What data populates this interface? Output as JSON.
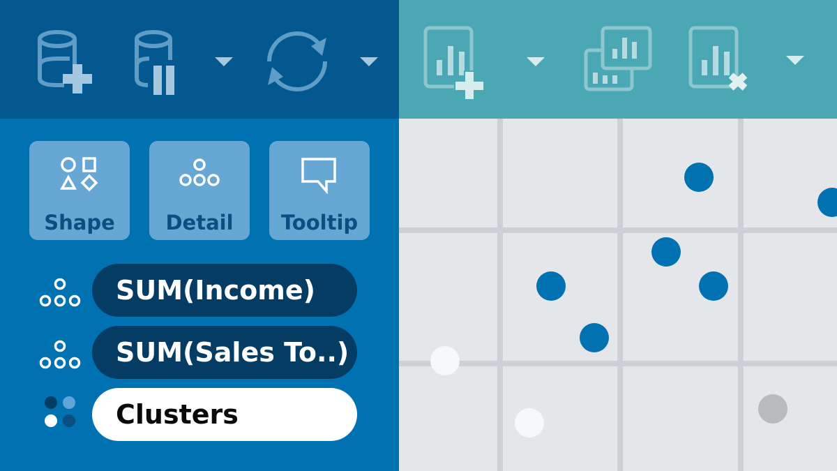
{
  "toolbar_left": {
    "icons": [
      "new-data-source-icon",
      "pause-auto-updates-icon",
      "dropdown-arrow-icon",
      "refresh-icon",
      "dropdown-arrow-icon"
    ]
  },
  "toolbar_right": {
    "icons": [
      "new-worksheet-icon",
      "dropdown-arrow-icon",
      "duplicate-sheet-icon",
      "clear-sheet-icon",
      "dropdown-arrow-icon"
    ]
  },
  "marks_card": {
    "buttons": [
      {
        "label": "Shape",
        "icon": "shape-icon"
      },
      {
        "label": "Detail",
        "icon": "detail-icon"
      },
      {
        "label": "Tooltip",
        "icon": "tooltip-icon"
      }
    ],
    "fields": [
      {
        "label": "SUM(Income)",
        "icon": "detail-icon",
        "style": "dark"
      },
      {
        "label": "SUM(Sales To..)",
        "icon": "detail-icon",
        "style": "dark"
      },
      {
        "label": "Clusters",
        "icon": "color-icon",
        "style": "light"
      }
    ]
  },
  "colors": {
    "toolbar_left": "#03598f",
    "toolbar_right": "#4aa8b4",
    "panel": "#0072b1",
    "pill_dark": "#053c63",
    "view_bg": "#e4e6ea",
    "mark_blue": "#0072b1",
    "mark_white": "#f7f8fa",
    "mark_gray": "#b8babd"
  },
  "scatter": {
    "marks": [
      "blue",
      "blue",
      "blue",
      "blue",
      "blue",
      "blue",
      "white",
      "white",
      "gray"
    ]
  }
}
